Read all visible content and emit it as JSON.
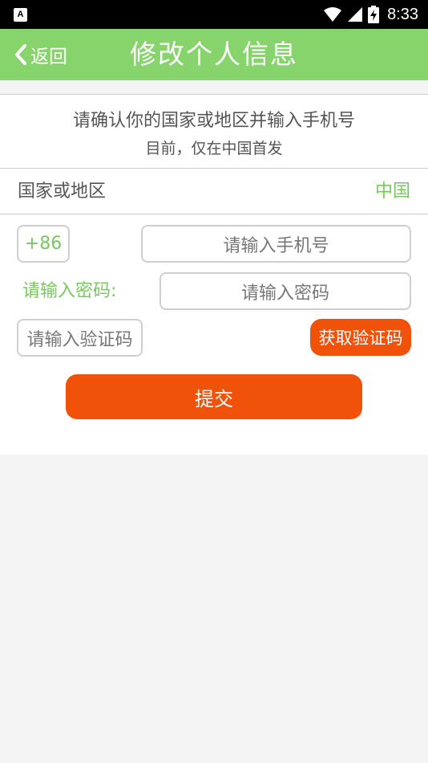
{
  "status_bar": {
    "left_icon_label": "A",
    "time": "8:33",
    "icons": [
      "wifi-icon",
      "signal-icon",
      "battery-charging-icon"
    ]
  },
  "header": {
    "back_label": "返回",
    "title": "修改个人信息",
    "background_color": "#86d46b"
  },
  "notice": {
    "main": "请确认你的国家或地区并输入手机号",
    "sub": "目前，仅在中国首发"
  },
  "region": {
    "label": "国家或地区",
    "value": "中国"
  },
  "form": {
    "country_code": "+86",
    "phone_placeholder": "请输入手机号",
    "password_label": "请输入密码:",
    "password_placeholder": "请输入密码",
    "code_placeholder": "请输入验证码",
    "get_code_label": "获取验证码",
    "submit_label": "提交"
  },
  "colors": {
    "accent_green": "#77c95d",
    "action_orange": "#f0520a"
  }
}
